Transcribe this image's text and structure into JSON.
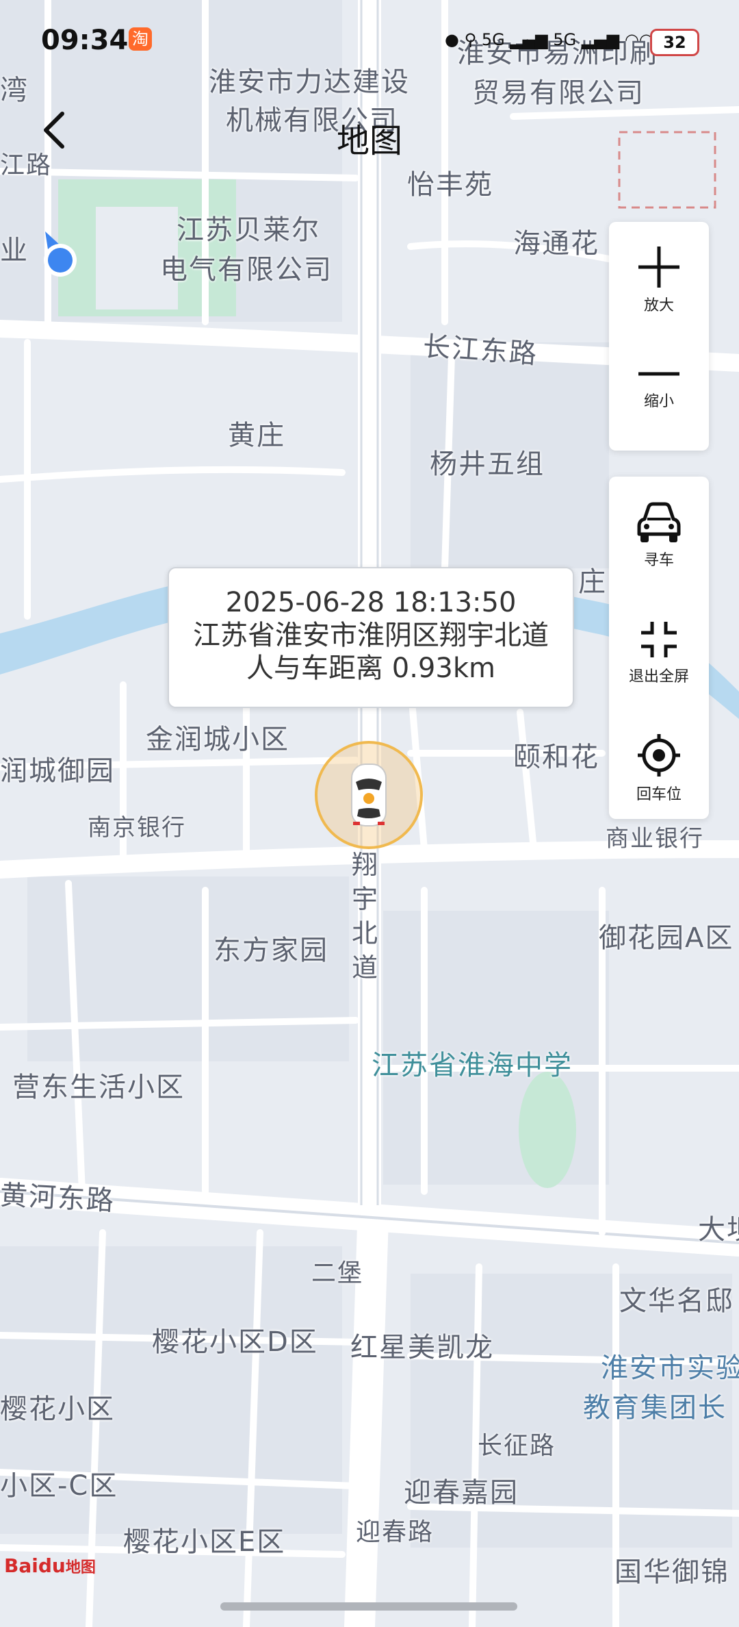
{
  "status_bar": {
    "time": "09:34",
    "app_badge": "淘",
    "network_1": "5G",
    "network_2": "5G",
    "battery": "32"
  },
  "header": {
    "title": "地图",
    "back_icon": "chevron-left-icon"
  },
  "controls": {
    "zoom_in": "放大",
    "zoom_out": "缩小",
    "find_car": "寻车",
    "exit_fullscreen": "退出全屏",
    "locate_car": "回车位"
  },
  "popup": {
    "datetime": "2025-06-28 18:13:50",
    "address": "江苏省淮安市淮阴区翔宇北道",
    "distance": "人与车距离 0.93km"
  },
  "map_labels": {
    "l01": "淮安市力达建设",
    "l02": "机械有限公司",
    "l03": "淮安市易洲印刷",
    "l04": "贸易有限公司",
    "l05": "怡丰苑",
    "l06": "江苏贝莱尔",
    "l07": "电气有限公司",
    "l08": "海通花",
    "l09": "长江东路",
    "l10": "黄庄",
    "l11": "杨井五组",
    "l12": "庄",
    "l13": "金润城小区",
    "l14": "润城御园",
    "l15": "颐和花",
    "l16": "南京银行",
    "l17": "商业银行",
    "l18": "翔",
    "l19": "宇",
    "l20": "北",
    "l21": "道",
    "l22": "东方家园",
    "l23": "御花园A区",
    "l24": "江苏省淮海中学",
    "l25": "营东生活小区",
    "l26": "黄河东路",
    "l27": "大坝",
    "l28": "二堡",
    "l29": "文华名邸",
    "l30": "樱花小区D区",
    "l31": "红星美凯龙",
    "l32": "淮安市实验",
    "l33": "教育集团长",
    "l34": "樱花小区",
    "l35": "长征路",
    "l36": "小区-C区",
    "l37": "迎春嘉园",
    "l38": "樱花小区E区",
    "l39": "迎春路",
    "l40": "国华御锦",
    "l41": "江路",
    "l42": "湾",
    "l43": "业"
  },
  "logo": {
    "baidu": "Baidu",
    "map": "地图"
  },
  "colors": {
    "road": "#ffffff",
    "water": "#b7d9f0",
    "green": "#c6e8d6",
    "car_ring": "#f0b94f",
    "location_blue": "#3d86f0"
  }
}
